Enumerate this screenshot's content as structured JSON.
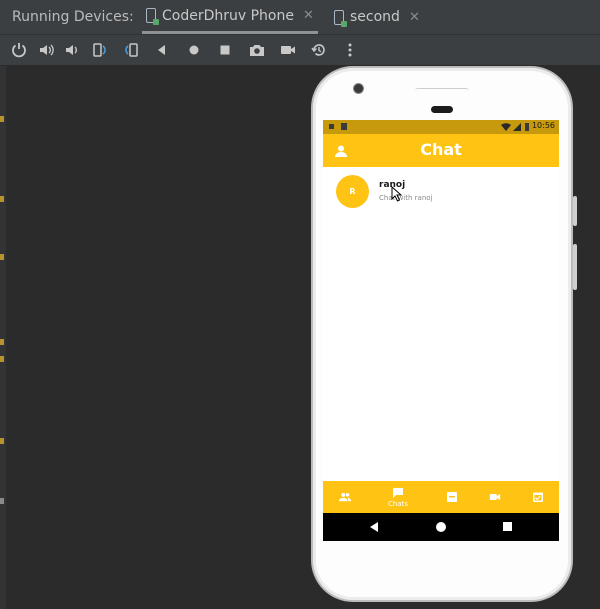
{
  "ide": {
    "panel_label": "Running Devices:",
    "tabs": [
      {
        "label": "CoderDhruv Phone",
        "active": true
      },
      {
        "label": "second",
        "active": false
      }
    ],
    "toolbar_icons": [
      "power-icon",
      "volume-up-icon",
      "volume-down-icon",
      "rotate-left-icon",
      "rotate-right-icon",
      "back-icon",
      "home-icon",
      "overview-icon",
      "screenshot-icon",
      "screen-record-icon",
      "snapshot-icon",
      "more-icon"
    ]
  },
  "device": {
    "status_time": "10:56",
    "appbar": {
      "title": "Chat"
    },
    "chats": [
      {
        "initial": "R",
        "name": "ranoj",
        "last_message": "Chat with ranoj"
      }
    ],
    "bottom_nav": [
      {
        "icon": "people-icon",
        "label": ""
      },
      {
        "icon": "chat-icon",
        "label": "Chats",
        "active": true
      },
      {
        "icon": "message-icon",
        "label": ""
      },
      {
        "icon": "video-icon",
        "label": ""
      },
      {
        "icon": "calendar-icon",
        "label": ""
      }
    ]
  },
  "colors": {
    "accent": "#ffc313",
    "status_bar": "#c79a0d",
    "ide_bg": "#2b2b2b",
    "ide_panel": "#3c3f41"
  }
}
